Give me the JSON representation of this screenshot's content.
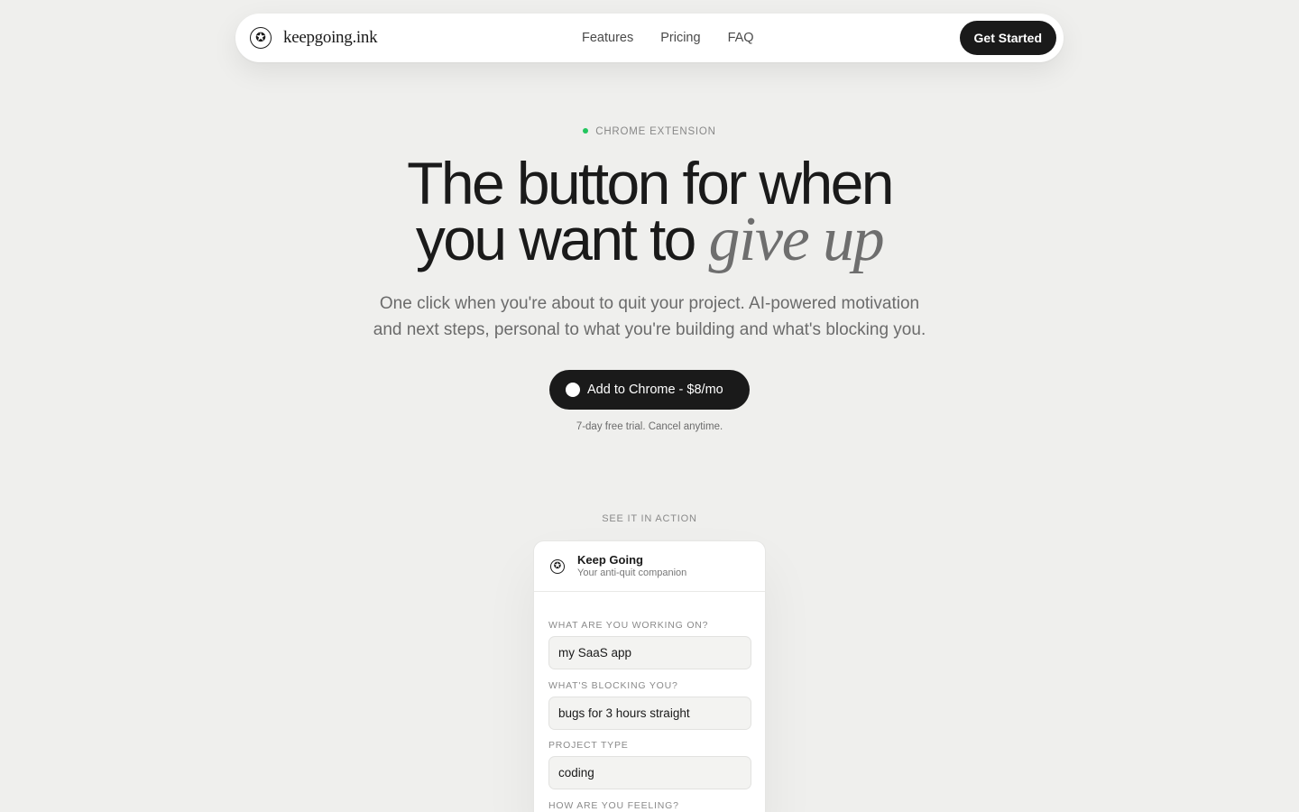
{
  "nav": {
    "brand_icon": "✪",
    "brand_name": "keepgoing.ink",
    "links": [
      "Features",
      "Pricing",
      "FAQ"
    ],
    "cta": "Get Started"
  },
  "hero": {
    "eyebrow": "CHROME EXTENSION",
    "headline_line1": "The button for when",
    "headline_line2": "you want to",
    "headline_accent": "give up",
    "subtext_line1": "One click when you're about to quit your project. AI-powered motivation",
    "subtext_line2": "and next steps, personal to what you're building and what's blocking you.",
    "cta": "Add to Chrome - $8/mo",
    "trial_note": "7-day free trial. Cancel anytime."
  },
  "demo": {
    "section_label": "SEE IT IN ACTION",
    "app_icon": "✪",
    "app_title": "Keep Going",
    "app_subtitle": "Your anti-quit companion",
    "fields": [
      {
        "label": "WHAT ARE YOU WORKING ON?",
        "value": "my SaaS app"
      },
      {
        "label": "WHAT'S BLOCKING YOU?",
        "value": "bugs for 3 hours straight"
      },
      {
        "label": "PROJECT TYPE",
        "value": "coding"
      },
      {
        "label": "HOW ARE YOU FEELING?",
        "value": ""
      }
    ]
  },
  "colors": {
    "background": "#efefed",
    "primary": "#1a1a1a",
    "status_dot": "#22c55e"
  }
}
